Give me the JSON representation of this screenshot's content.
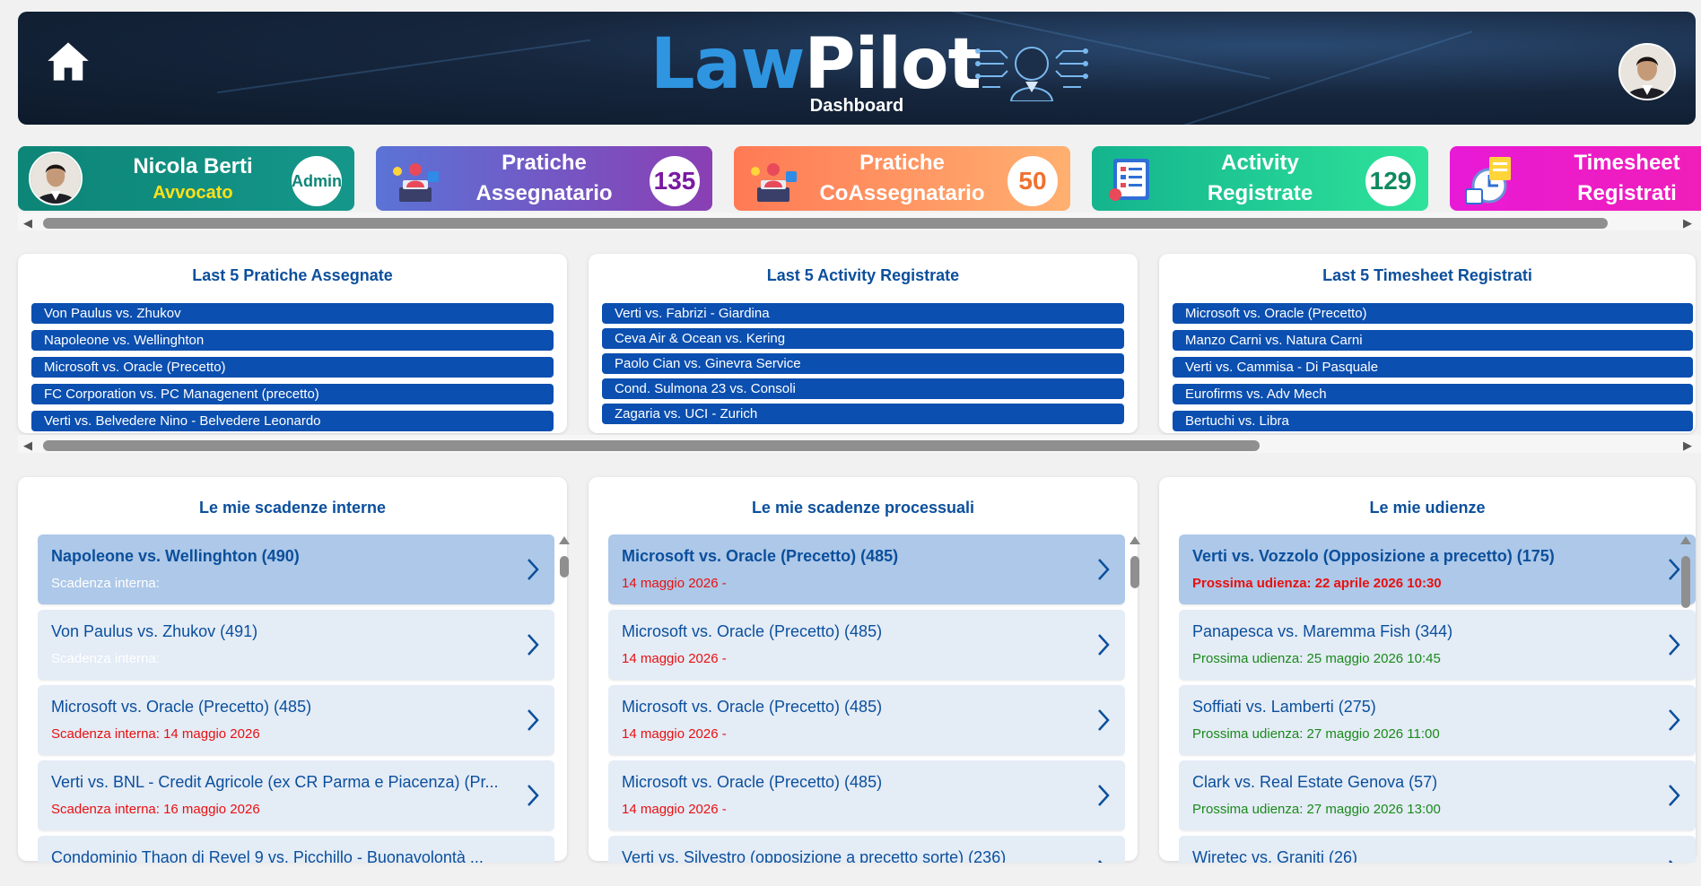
{
  "header": {
    "logo_law": "Law",
    "logo_pilot": "Pilot",
    "subtitle": "Dashboard",
    "home_icon": "home-icon",
    "avatar_icon": "user-avatar"
  },
  "cards": [
    {
      "title_line1": "Nicola Berti",
      "title_line2": "Avvocato",
      "badge": "Admin",
      "color": "#0f8a7e"
    },
    {
      "title_line1": "Pratiche",
      "title_line2": "Assegnatario",
      "badge": "135",
      "color": "#6b5cc9"
    },
    {
      "title_line1": "Pratiche",
      "title_line2": "CoAssegnatario",
      "badge": "50",
      "color": "#ff8a5c"
    },
    {
      "title_line1": "Activity",
      "title_line2": "Registrate",
      "badge": "129",
      "color": "#1fc49b"
    },
    {
      "title_line1": "Timesheet",
      "title_line2": "Registrati",
      "badge": "",
      "color": "#e81ad6"
    }
  ],
  "last5": [
    {
      "title": "Last 5 Pratiche Assegnate",
      "items": [
        "Von Paulus vs. Zhukov",
        "Napoleone vs. Wellinghton",
        "Microsoft vs. Oracle (Precetto)",
        "FC Corporation vs. PC Managenent (precetto)",
        "Verti vs. Belvedere Nino - Belvedere Leonardo"
      ]
    },
    {
      "title": "Last 5 Activity Registrate",
      "items": [
        "Verti vs. Fabrizi - Giardina",
        "Ceva Air & Ocean vs. Kering",
        "Paolo Cian vs. Ginevra Service",
        "Cond. Sulmona 23 vs. Consoli",
        "Zagaria vs. UCI - Zurich"
      ]
    },
    {
      "title": "Last 5 Timesheet Registrati",
      "items": [
        "Microsoft vs. Oracle (Precetto)",
        "Manzo Carni vs. Natura Carni",
        "Verti vs. Cammisa - Di Pasquale",
        "Eurofirms vs. Adv Mech",
        "Bertuchi vs. Libra"
      ]
    }
  ],
  "deadlines": [
    {
      "title": "Le mie scadenze interne",
      "items": [
        {
          "title": "Napoleone vs. Wellinghton (490)",
          "sub": "Scadenza interna:",
          "sub_color": "#ffffff",
          "selected": true
        },
        {
          "title": "Von Paulus vs. Zhukov (491)",
          "sub": "Scadenza interna:",
          "sub_color": "#ffffff",
          "selected": false
        },
        {
          "title": "Microsoft vs. Oracle (Precetto) (485)",
          "sub": "Scadenza interna: 14 maggio 2026",
          "sub_color": "#e81010",
          "selected": false
        },
        {
          "title": "Verti vs. BNL - Credit Agricole (ex CR Parma e Piacenza) (Pr...",
          "sub": "Scadenza interna: 16 maggio 2026",
          "sub_color": "#e81010",
          "selected": false
        },
        {
          "title": "Condominio Thaon di Revel 9 vs. Picchillo - Buonavolontà ...",
          "sub": "",
          "sub_color": "#e81010",
          "selected": false
        }
      ]
    },
    {
      "title": "Le mie scadenze processuali",
      "items": [
        {
          "title": "Microsoft vs. Oracle (Precetto) (485)",
          "sub": "14 maggio 2026 -",
          "sub_color": "#e81010",
          "selected": true
        },
        {
          "title": "Microsoft vs. Oracle (Precetto) (485)",
          "sub": "14 maggio 2026 -",
          "sub_color": "#e81010",
          "selected": false
        },
        {
          "title": "Microsoft vs. Oracle (Precetto) (485)",
          "sub": "14 maggio 2026 -",
          "sub_color": "#e81010",
          "selected": false
        },
        {
          "title": "Microsoft vs. Oracle (Precetto) (485)",
          "sub": "14 maggio 2026 -",
          "sub_color": "#e81010",
          "selected": false
        },
        {
          "title": "Verti vs. Silvestro (opposizione a precetto sorte) (236)",
          "sub": "",
          "sub_color": "#e81010",
          "selected": false
        }
      ]
    },
    {
      "title": "Le mie udienze",
      "items": [
        {
          "title": "Verti vs. Vozzolo (Opposizione a precetto) (175)",
          "sub": "Prossima udienza: 22 aprile 2026 10:30",
          "sub_color": "#e81010",
          "selected": true
        },
        {
          "title": "Panapesca vs. Maremma Fish (344)",
          "sub": "Prossima udienza: 25 maggio 2026 10:45",
          "sub_color": "#1a8a1a",
          "selected": false
        },
        {
          "title": "Soffiati vs. Lamberti (275)",
          "sub": "Prossima udienza: 27 maggio 2026 11:00",
          "sub_color": "#1a8a1a",
          "selected": false
        },
        {
          "title": "Clark vs. Real Estate Genova (57)",
          "sub": "Prossima udienza: 27 maggio 2026 13:00",
          "sub_color": "#1a8a1a",
          "selected": false
        },
        {
          "title": "Wiretec vs. Graniti (26)",
          "sub": "",
          "sub_color": "#1a8a1a",
          "selected": false
        }
      ]
    }
  ]
}
